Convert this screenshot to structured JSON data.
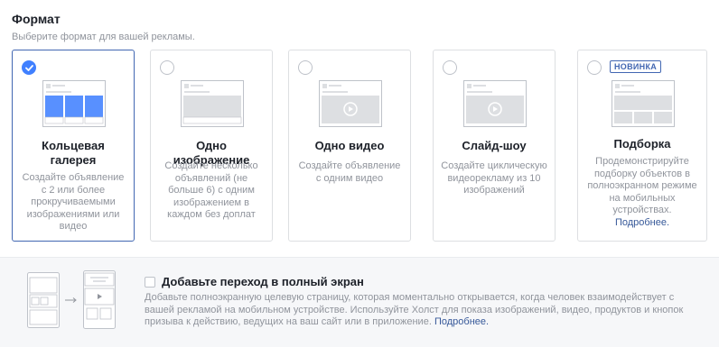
{
  "header": {
    "title": "Формат",
    "subtitle": "Выберите формат для вашей рекламы."
  },
  "cards": [
    {
      "title": "Кольцевая галерея",
      "description": "Создайте объявление с 2 или более прокручиваемыми изображениями или видео",
      "selected": true
    },
    {
      "title": "Одно изображение",
      "description": "Создайте несколько объявлений (не больше 6) с одним изображением в каждом без доплат",
      "selected": false
    },
    {
      "title": "Одно видео",
      "description": "Создайте объявление с одним видео",
      "selected": false
    },
    {
      "title": "Слайд-шоу",
      "description": "Создайте циклическую видеорекламу из 10 изображений",
      "selected": false
    },
    {
      "title": "Подборка",
      "badge": "НОВИНКА",
      "description": "Продемонстрируйте подборку объектов в полноэкранном режиме на мобильных устройствах.",
      "link": "Подробнее.",
      "selected": false
    }
  ],
  "fullscreen": {
    "title": "Добавьте переход в полный экран",
    "description": "Добавьте полноэкранную целевую страницу, которая моментально открывается, когда человек взаимодействует с вашей рекламой на мобильном устройстве. Используйте Холст для показа изображений, видео, продуктов и кнопок призыва к действию, ведущих на ваш сайт или в приложение.",
    "link": "Подробнее.",
    "checked": false
  },
  "colors": {
    "accent": "#4080ff",
    "selected_border": "#4267b2",
    "link": "#365899",
    "muted_text": "#90949c"
  }
}
